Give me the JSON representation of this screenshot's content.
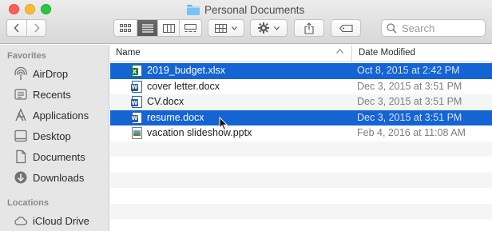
{
  "window": {
    "title": "Personal Documents"
  },
  "toolbar": {
    "back_icon": "chevron-left-icon",
    "forward_icon": "chevron-right-icon",
    "view_modes": [
      "icon-view-icon",
      "list-view-icon",
      "column-view-icon",
      "gallery-view-icon"
    ],
    "active_view": "list",
    "group_icon": "grid-group-icon",
    "action_icon": "gear-icon",
    "share_icon": "share-icon",
    "tag_icon": "tag-icon"
  },
  "search": {
    "placeholder": "Search",
    "value": ""
  },
  "sidebar": {
    "favorites_heading": "Favorites",
    "favorites": [
      {
        "label": "AirDrop",
        "icon": "airdrop-icon"
      },
      {
        "label": "Recents",
        "icon": "clock-icon"
      },
      {
        "label": "Applications",
        "icon": "applications-icon"
      },
      {
        "label": "Desktop",
        "icon": "desktop-icon"
      },
      {
        "label": "Documents",
        "icon": "document-icon"
      },
      {
        "label": "Downloads",
        "icon": "download-icon"
      }
    ],
    "locations_heading": "Locations",
    "locations": [
      {
        "label": "iCloud Drive",
        "icon": "cloud-icon"
      }
    ]
  },
  "list": {
    "columns": {
      "name": "Name",
      "date_modified": "Date Modified"
    },
    "files": [
      {
        "name": "2019_budget.xlsx",
        "date": "Oct 8, 2015 at 2:42 PM",
        "type": "xlsx",
        "selected": true
      },
      {
        "name": "cover letter.docx",
        "date": "Dec 3, 2015 at 3:51 PM",
        "type": "docx",
        "selected": false
      },
      {
        "name": "CV.docx",
        "date": "Dec 3, 2015 at 3:51 PM",
        "type": "docx",
        "selected": false
      },
      {
        "name": "resume.docx",
        "date": "Dec 3, 2015 at 3:51 PM",
        "type": "docx",
        "selected": true
      },
      {
        "name": "vacation slideshow.pptx",
        "date": "Feb 4, 2016 at 11:08 AM",
        "type": "pptx",
        "selected": false
      }
    ]
  },
  "colors": {
    "selection": "#1464d3",
    "sidebar_bg": "#e6e6e6",
    "alt_row": "#f4f5f5"
  }
}
